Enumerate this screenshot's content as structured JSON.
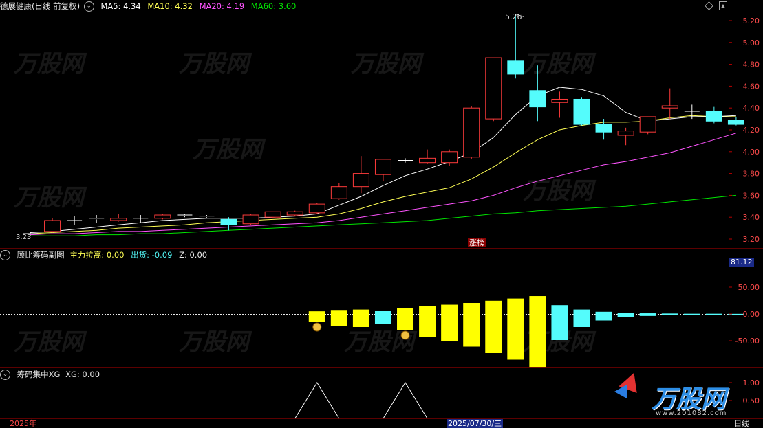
{
  "main_header": {
    "title": "德展健康(日线 前复权)",
    "ma5": "MA5: 4.34",
    "ma10": "MA10: 4.32",
    "ma20": "MA20: 4.19",
    "ma60": "MA60: 3.60",
    "menu_icon": "chevron-down-icon"
  },
  "main_chart": {
    "y_ticks": [
      "5.20",
      "5.00",
      "4.80",
      "4.60",
      "4.40",
      "4.20",
      "4.00",
      "3.80",
      "3.60",
      "3.40",
      "3.20"
    ],
    "high_label": "5.26",
    "low_label": "3.23",
    "event_tag": "涨榜"
  },
  "sub1_header": {
    "title": "顾比筹码副图",
    "main_force": "主力拉高: 0.00",
    "out_label": "出货: -0.09",
    "z_label": "Z: 0.00"
  },
  "sub1_chart": {
    "y_ticks": [
      "50.00",
      "0.00",
      "-50.00"
    ],
    "current_value": "81.12"
  },
  "sub2_header": {
    "title": "筹码集中XG",
    "xg": "XG: 0.00"
  },
  "sub2_chart": {
    "y_ticks": [
      "1.00",
      "0.50"
    ]
  },
  "footer": {
    "year_label": "2025年",
    "cursor_date": "2025/07/30/三",
    "period_label": "日线"
  },
  "brand": {
    "name": "万股网",
    "url": "www.201082.com"
  },
  "colors": {
    "up": "#ff3b3b",
    "down": "#54fcfc",
    "ma5": "#ffffff",
    "ma10": "#ffff54",
    "ma20": "#ff54ff",
    "ma60": "#00e600",
    "bar_yellow": "#ffff00",
    "bar_cyan": "#54fcfc",
    "axis": "#b80000"
  },
  "chart_data": {
    "type": "candlestick",
    "price_range": [
      3.18,
      5.3
    ],
    "candles": [
      {
        "o": 3.24,
        "h": 3.26,
        "l": 3.23,
        "c": 3.25
      },
      {
        "o": 3.27,
        "h": 3.39,
        "l": 3.26,
        "c": 3.37
      },
      {
        "o": 3.37,
        "h": 3.41,
        "l": 3.33,
        "c": 3.37
      },
      {
        "o": 3.38,
        "h": 3.42,
        "l": 3.35,
        "c": 3.39
      },
      {
        "o": 3.37,
        "h": 3.43,
        "l": 3.36,
        "c": 3.39
      },
      {
        "o": 3.39,
        "h": 3.42,
        "l": 3.35,
        "c": 3.39
      },
      {
        "o": 3.39,
        "h": 3.43,
        "l": 3.38,
        "c": 3.42
      },
      {
        "o": 3.42,
        "h": 3.43,
        "l": 3.4,
        "c": 3.41
      },
      {
        "o": 3.41,
        "h": 3.42,
        "l": 3.39,
        "c": 3.4
      },
      {
        "o": 3.38,
        "h": 3.4,
        "l": 3.28,
        "c": 3.33
      },
      {
        "o": 3.34,
        "h": 3.43,
        "l": 3.33,
        "c": 3.42
      },
      {
        "o": 3.4,
        "h": 3.45,
        "l": 3.39,
        "c": 3.45
      },
      {
        "o": 3.42,
        "h": 3.46,
        "l": 3.41,
        "c": 3.45
      },
      {
        "o": 3.44,
        "h": 3.53,
        "l": 3.43,
        "c": 3.52
      },
      {
        "o": 3.57,
        "h": 3.71,
        "l": 3.56,
        "c": 3.68
      },
      {
        "o": 3.68,
        "h": 3.96,
        "l": 3.62,
        "c": 3.8
      },
      {
        "o": 3.79,
        "h": 3.93,
        "l": 3.73,
        "c": 3.93
      },
      {
        "o": 3.92,
        "h": 3.94,
        "l": 3.9,
        "c": 3.92
      },
      {
        "o": 3.9,
        "h": 4.02,
        "l": 3.89,
        "c": 3.94
      },
      {
        "o": 3.9,
        "h": 4.02,
        "l": 3.87,
        "c": 4.0
      },
      {
        "o": 3.95,
        "h": 4.42,
        "l": 3.93,
        "c": 4.4
      },
      {
        "o": 4.3,
        "h": 4.86,
        "l": 4.28,
        "c": 4.86
      },
      {
        "o": 4.83,
        "h": 5.26,
        "l": 4.67,
        "c": 4.71
      },
      {
        "o": 4.56,
        "h": 4.79,
        "l": 4.28,
        "c": 4.41
      },
      {
        "o": 4.45,
        "h": 4.55,
        "l": 4.31,
        "c": 4.48
      },
      {
        "o": 4.48,
        "h": 4.5,
        "l": 4.24,
        "c": 4.25
      },
      {
        "o": 4.25,
        "h": 4.3,
        "l": 4.11,
        "c": 4.18
      },
      {
        "o": 4.15,
        "h": 4.22,
        "l": 4.06,
        "c": 4.19
      },
      {
        "o": 4.18,
        "h": 4.32,
        "l": 4.16,
        "c": 4.32
      },
      {
        "o": 4.4,
        "h": 4.58,
        "l": 4.3,
        "c": 4.42
      },
      {
        "o": 4.37,
        "h": 4.43,
        "l": 4.3,
        "c": 4.37
      },
      {
        "o": 4.37,
        "h": 4.41,
        "l": 4.26,
        "c": 4.28
      },
      {
        "o": 4.29,
        "h": 4.32,
        "l": 4.24,
        "c": 4.25
      }
    ],
    "ma5": [
      3.26,
      3.27,
      3.29,
      3.31,
      3.33,
      3.35,
      3.37,
      3.38,
      3.39,
      3.39,
      3.39,
      3.4,
      3.41,
      3.43,
      3.51,
      3.59,
      3.69,
      3.78,
      3.84,
      3.91,
      3.99,
      4.13,
      4.34,
      4.51,
      4.59,
      4.57,
      4.51,
      4.36,
      4.28,
      4.3,
      4.32,
      4.32,
      4.33
    ],
    "ma10": [
      3.25,
      3.26,
      3.27,
      3.28,
      3.3,
      3.31,
      3.32,
      3.33,
      3.35,
      3.36,
      3.37,
      3.38,
      3.39,
      3.4,
      3.43,
      3.48,
      3.54,
      3.59,
      3.63,
      3.67,
      3.75,
      3.86,
      3.99,
      4.11,
      4.2,
      4.24,
      4.27,
      4.27,
      4.28,
      4.31,
      4.33,
      4.32,
      4.32
    ],
    "ma20": [
      3.24,
      3.25,
      3.25,
      3.26,
      3.27,
      3.27,
      3.28,
      3.29,
      3.3,
      3.31,
      3.32,
      3.33,
      3.34,
      3.35,
      3.37,
      3.4,
      3.43,
      3.46,
      3.49,
      3.52,
      3.55,
      3.6,
      3.67,
      3.73,
      3.78,
      3.83,
      3.88,
      3.91,
      3.95,
      3.99,
      4.05,
      4.11,
      4.17
    ],
    "ma60": [
      3.23,
      3.23,
      3.23,
      3.24,
      3.24,
      3.25,
      3.25,
      3.26,
      3.27,
      3.28,
      3.29,
      3.3,
      3.31,
      3.32,
      3.33,
      3.34,
      3.35,
      3.36,
      3.37,
      3.39,
      3.41,
      3.43,
      3.44,
      3.46,
      3.47,
      3.48,
      3.49,
      3.5,
      3.52,
      3.54,
      3.56,
      3.58,
      3.6
    ],
    "sub_bars": [
      {
        "v": -12,
        "c": "yellow"
      },
      {
        "v": -18,
        "c": "yellow"
      },
      {
        "v": -20,
        "c": "yellow"
      },
      {
        "v": -15,
        "c": "cyan"
      },
      {
        "v": -25,
        "c": "yellow"
      },
      {
        "v": -35,
        "c": "yellow"
      },
      {
        "v": -42,
        "c": "yellow"
      },
      {
        "v": -50,
        "c": "yellow"
      },
      {
        "v": -60,
        "c": "yellow"
      },
      {
        "v": -70,
        "c": "yellow"
      },
      {
        "v": -81.12,
        "c": "yellow"
      },
      {
        "v": -40,
        "c": "cyan"
      },
      {
        "v": -20,
        "c": "cyan"
      },
      {
        "v": -10,
        "c": "cyan"
      },
      {
        "v": -5,
        "c": "cyan"
      },
      {
        "v": -3,
        "c": "cyan"
      },
      {
        "v": -2,
        "c": "cyan"
      },
      {
        "v": -1,
        "c": "cyan"
      },
      {
        "v": -1,
        "c": "cyan"
      },
      {
        "v": -0.5,
        "c": "cyan"
      }
    ],
    "sub_bar_start_index": 13,
    "xg_peaks_at": [
      13,
      17
    ]
  }
}
